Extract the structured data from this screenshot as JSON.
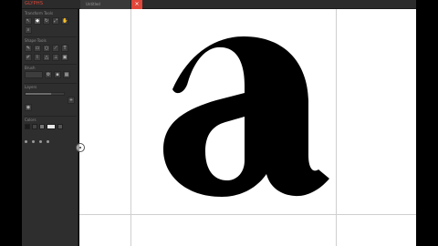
{
  "app": {
    "title": "GLYPHS",
    "accent": "#e0473a"
  },
  "tabs": [
    {
      "label": "Untitled"
    }
  ],
  "tab_close_icon": "close-icon",
  "sidebar": {
    "sections": [
      {
        "title": "Transform Tools"
      },
      {
        "title": "Shape Tools"
      },
      {
        "title": "Brush"
      },
      {
        "title": "Layers"
      },
      {
        "title": "Colors"
      }
    ]
  },
  "canvas": {
    "glyph": "a",
    "glyph_color": "#000000",
    "background": "#ffffff"
  }
}
